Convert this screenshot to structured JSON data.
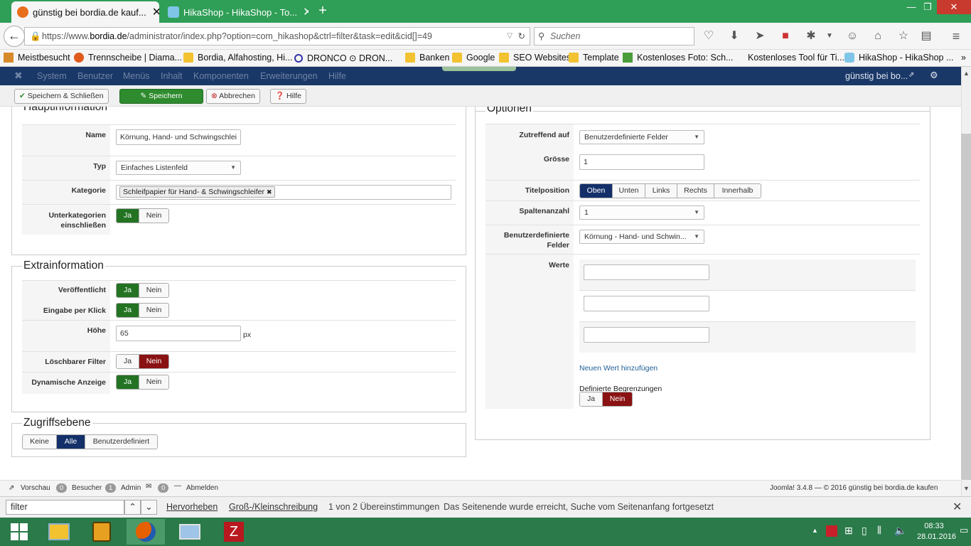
{
  "browser": {
    "tabs": [
      {
        "title": "günstig bei bordia.de kauf..."
      },
      {
        "title": "HikaShop - HikaShop - To..."
      }
    ],
    "url_prefix": "https://www.",
    "url_domain": "bordia.de",
    "url_rest": "/administrator/index.php?option=com_hikashop&ctrl=filter&task=edit&cid[]=49",
    "search_placeholder": "Suchen",
    "bookmarks": [
      "Meistbesucht",
      "Trennscheibe | Diama...",
      "Bordia, Alfahosting, Hi...",
      "DRONCO ⊙ DRON...",
      "Banken",
      "Google",
      "SEO Websites",
      "Template",
      "Kostenloses Foto: Sch...",
      "Kostenloses Tool für Ti...",
      "HikaShop - HikaShop ..."
    ]
  },
  "joomla_menu": {
    "items": [
      "System",
      "Benutzer",
      "Menüs",
      "Inhalt",
      "Komponenten",
      "Erweiterungen",
      "Hilfe"
    ],
    "site_link": "günstig bei bo..."
  },
  "toolbar": {
    "save_close": "Speichern & Schließen",
    "save": "Speichern",
    "cancel": "Abbrechen",
    "help": "Hilfe"
  },
  "haupt": {
    "legend": "Hauptinformation",
    "name_label": "Name",
    "name_value": "Körnung, Hand- und Schwingschlei",
    "typ_label": "Typ",
    "typ_value": "Einfaches Listenfeld",
    "kategorie_label": "Kategorie",
    "kategorie_chip": "Schleifpapier für Hand- & Schwingschleifer",
    "unterkat_label_1": "Unterkategorien",
    "unterkat_label_2": "einschließen",
    "ja": "Ja",
    "nein": "Nein"
  },
  "extra": {
    "legend": "Extrainformation",
    "veroeff_label": "Veröffentlicht",
    "eingabe_label": "Eingabe per Klick",
    "hoehe_label": "Höhe",
    "hoehe_value": "65",
    "hoehe_unit": "px",
    "loesch_label": "Löschbarer Filter",
    "dyn_label": "Dynamische Anzeige"
  },
  "zugriff": {
    "legend": "Zugriffsebene",
    "options": [
      "Keine",
      "Alle",
      "Benutzerdefiniert"
    ]
  },
  "optionen": {
    "legend": "Optionen",
    "zutreffend_label": "Zutreffend auf",
    "zutreffend_value": "Benutzerdefinierte Felder",
    "groesse_label": "Grösse",
    "groesse_value": "1",
    "titelpos_label": "Titelposition",
    "titelpos_options": [
      "Oben",
      "Unten",
      "Links",
      "Rechts",
      "Innerhalb"
    ],
    "spalten_label": "Spaltenanzahl",
    "spalten_value": "1",
    "benutzerdef_label_1": "Benutzerdefinierte",
    "benutzerdef_label_2": "Felder",
    "benutzerdef_value": "Körnung - Hand- und Schwin...",
    "werte_label": "Werte",
    "add_value_link": "Neuen Wert hinzufügen",
    "definierte_label": "Definierte Begrenzungen"
  },
  "status_bar": {
    "vorschau": "Vorschau",
    "besucher_count": "0",
    "besucher": "Besucher",
    "admin_count": "1",
    "admin": "Admin",
    "msg_count": "0",
    "abmelden": "Abmelden",
    "copyright": "Joomla! 3.4.8  —  © 2016 günstig bei bordia.de kaufen"
  },
  "find_bar": {
    "query": "filter",
    "highlight": "Hervorheben",
    "case": "Groß-/Kleinschreibung",
    "matches": "1 von 2 Übereinstimmungen",
    "message": "Das Seitenende wurde erreicht, Suche vom Seitenanfang fortgesetzt"
  },
  "taskbar": {
    "time": "08:33",
    "date": "28.01.2016"
  },
  "colors": {
    "browser_green": "#2f9e57",
    "joomla_navy": "#1a3867",
    "toggle_green": "#237323",
    "toggle_red": "#8a1212",
    "toggle_blue": "#14306a"
  }
}
